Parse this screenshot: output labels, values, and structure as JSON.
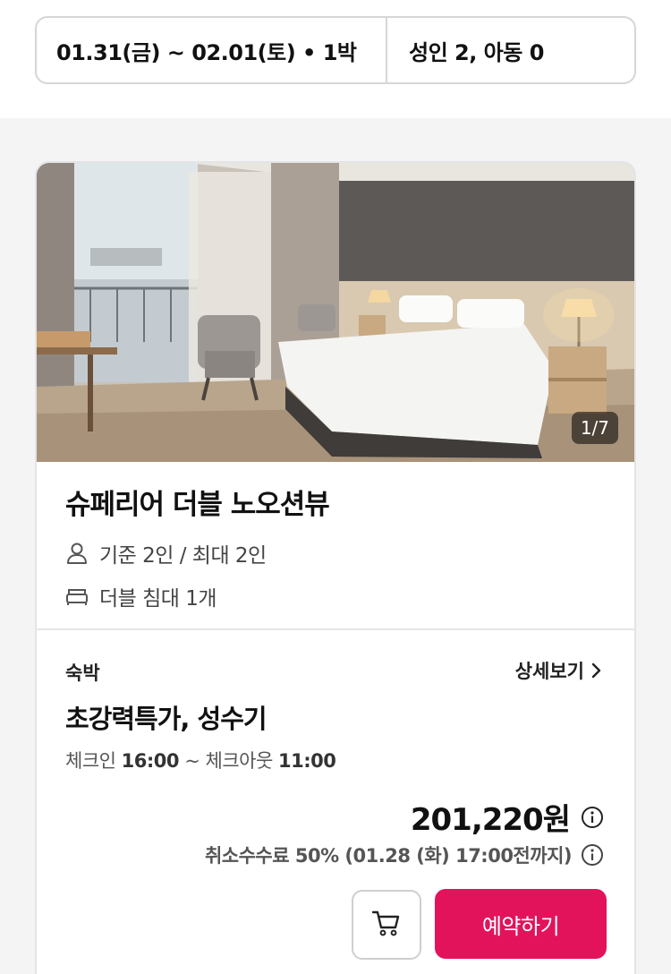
{
  "search": {
    "date_range": "01.31(금) ~ 02.01(토) • 1박",
    "guests": "성인 2, 아동 0"
  },
  "room": {
    "photo_counter": "1/7",
    "name": "슈페리어 더블 노오션뷰",
    "occupancy": "기준 2인 / 최대 2인",
    "bed": "더블 침대 1개"
  },
  "rate": {
    "type": "숙박",
    "detail_link": "상세보기",
    "name": "초강력특가, 성수기",
    "check_in_label": "체크인",
    "check_in_time": "16:00",
    "separator": "~",
    "check_out_label": "체크아웃",
    "check_out_time": "11:00",
    "price": "201,220원",
    "cancel_fee": "취소수수료 50% (01.28 (화) 17:00전까지)",
    "reserve_label": "예약하기"
  },
  "colors": {
    "accent": "#e2135b",
    "border": "#d6d6d8",
    "background": "#f4f4f5"
  },
  "icons": {
    "person": "person-icon",
    "bed": "bed-icon",
    "chevron": "chevron-right-icon",
    "info": "info-icon",
    "cart": "cart-icon"
  }
}
